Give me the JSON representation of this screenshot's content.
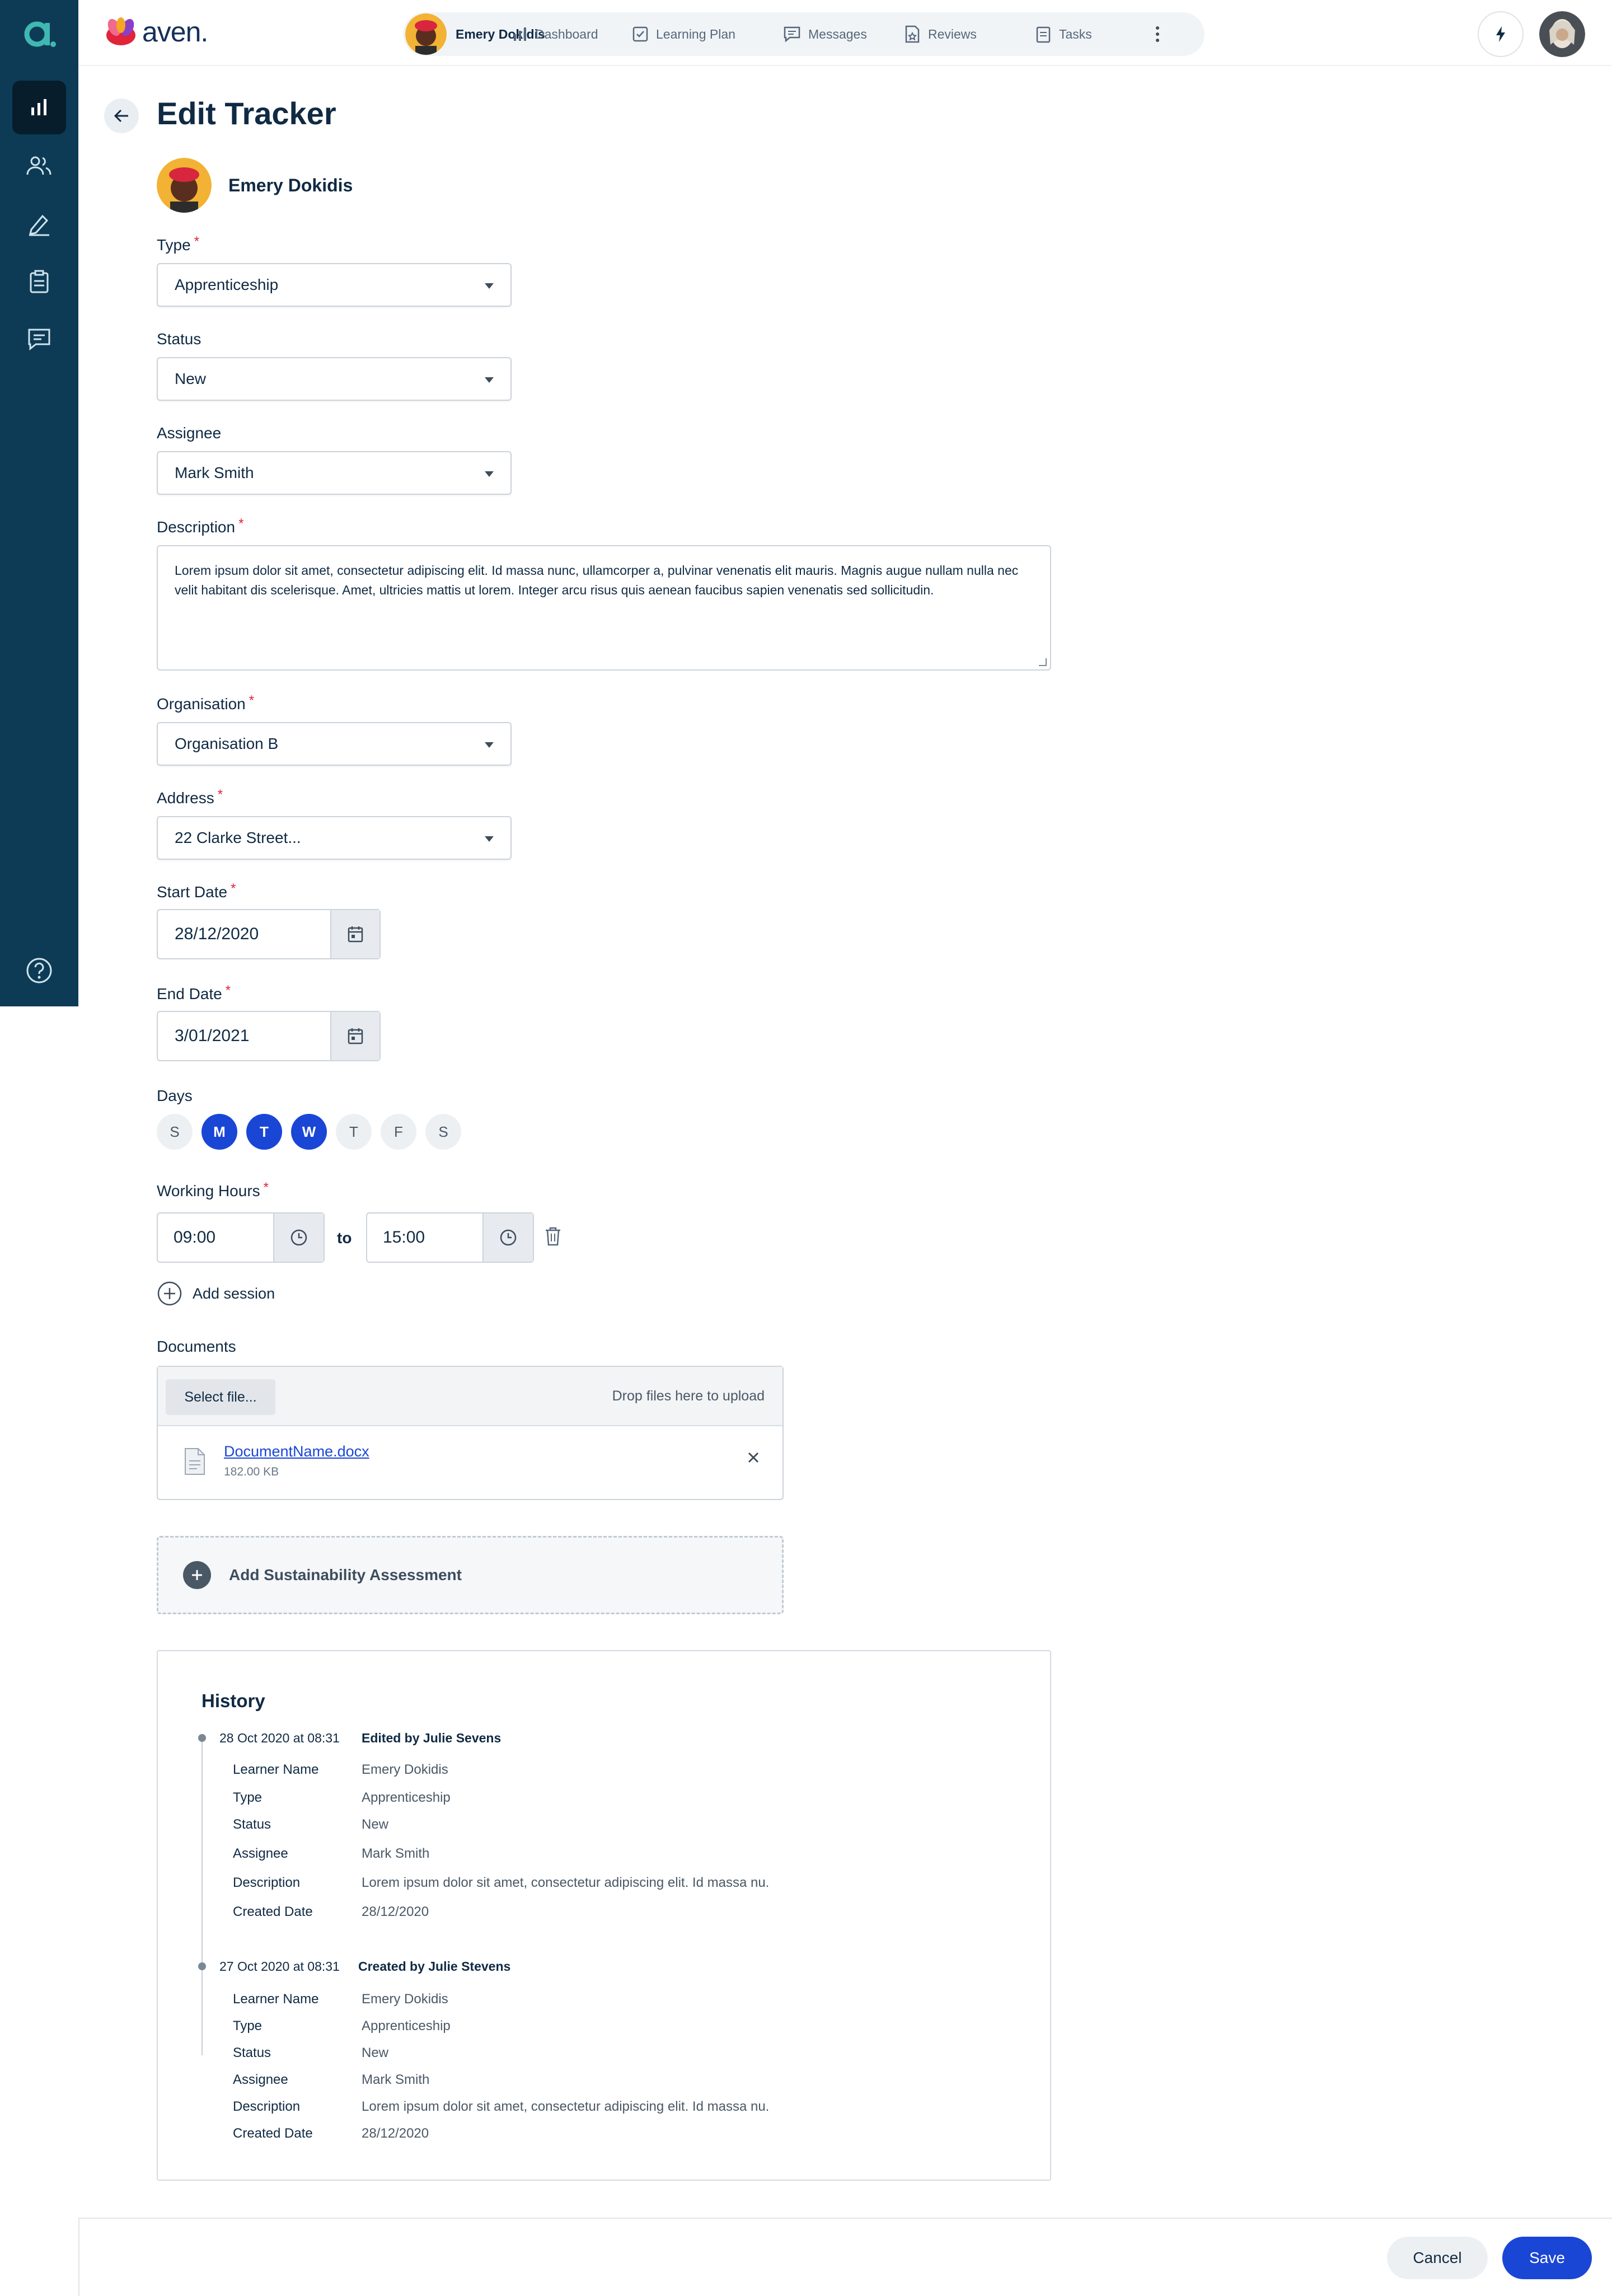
{
  "topbar": {
    "brand": "aven.",
    "user_name": "Emery Dokidis",
    "nav": [
      "Dashboard",
      "Learning Plan",
      "Messages",
      "Reviews",
      "Tasks"
    ]
  },
  "page": {
    "title": "Edit Tracker",
    "learner_name": "Emery Dokidis"
  },
  "form": {
    "type": {
      "label": "Type",
      "value": "Apprenticeship",
      "required": true
    },
    "status": {
      "label": "Status",
      "value": "New",
      "required": false
    },
    "assignee": {
      "label": "Assignee",
      "value": "Mark Smith",
      "required": false
    },
    "description": {
      "label": "Description",
      "value": "Lorem ipsum dolor sit amet, consectetur adipiscing elit. Id massa nunc, ullamcorper a, pulvinar venenatis elit mauris. Magnis augue nullam nulla nec velit habitant dis scelerisque. Amet, ultricies mattis ut lorem. Integer arcu risus quis aenean faucibus sapien venenatis sed sollicitudin.",
      "required": true
    },
    "organisation": {
      "label": "Organisation",
      "value": "Organisation B",
      "required": true
    },
    "address": {
      "label": "Address",
      "value": "22 Clarke Street...",
      "required": true
    },
    "start_date": {
      "label": "Start Date",
      "value": "28/12/2020",
      "required": true
    },
    "end_date": {
      "label": "End Date",
      "value": "3/01/2021",
      "required": true
    },
    "days": {
      "label": "Days",
      "items": [
        {
          "letter": "S",
          "selected": false
        },
        {
          "letter": "M",
          "selected": true
        },
        {
          "letter": "T",
          "selected": true
        },
        {
          "letter": "W",
          "selected": true
        },
        {
          "letter": "T",
          "selected": false
        },
        {
          "letter": "F",
          "selected": false
        },
        {
          "letter": "S",
          "selected": false
        }
      ]
    },
    "working_hours": {
      "label": "Working Hours",
      "from": "09:00",
      "to_label": "to",
      "to": "15:00",
      "required": true
    },
    "add_session": "Add session",
    "documents": {
      "label": "Documents",
      "select_button": "Select file...",
      "drop_hint": "Drop files here to upload",
      "file_name": "DocumentName.docx",
      "file_size": "182.00 KB"
    },
    "sustainability": "Add Sustainability Assessment"
  },
  "history": {
    "title": "History",
    "entries": [
      {
        "date": "28 Oct 2020  at 08:31",
        "by": "Edited by Julie Sevens",
        "rows": [
          {
            "k": "Learner Name",
            "v": "Emery Dokidis"
          },
          {
            "k": "Type",
            "v": "Apprenticeship"
          },
          {
            "k": "Status",
            "v": "New"
          },
          {
            "k": "Assignee",
            "v": "Mark Smith"
          },
          {
            "k": "Description",
            "v": "Lorem ipsum dolor sit amet, consectetur adipiscing elit. Id massa nu."
          },
          {
            "k": "Created Date",
            "v": "28/12/2020"
          }
        ]
      },
      {
        "date": "27 Oct 2020 at 08:31",
        "by": "Created by Julie Stevens",
        "rows": [
          {
            "k": "Learner Name",
            "v": "Emery Dokidis"
          },
          {
            "k": "Type",
            "v": "Apprenticeship"
          },
          {
            "k": "Status",
            "v": "New"
          },
          {
            "k": "Assignee",
            "v": "Mark Smith"
          },
          {
            "k": "Description",
            "v": "Lorem ipsum dolor sit amet, consectetur adipiscing elit. Id massa nu."
          },
          {
            "k": "Created Date",
            "v": "28/12/2020"
          }
        ]
      }
    ]
  },
  "footer": {
    "cancel": "Cancel",
    "save": "Save"
  },
  "colors": {
    "sidebar": "#0d3b55",
    "primary": "#1a46d6",
    "required": "#e0243a",
    "brand_teal": "#3fb8b2"
  },
  "icons": {
    "sidebar": [
      "chart-icon",
      "people-icon",
      "pen-icon",
      "clipboard-icon",
      "chat-icon",
      "help-icon"
    ],
    "top": [
      "bolt-icon",
      "more-icon"
    ]
  }
}
